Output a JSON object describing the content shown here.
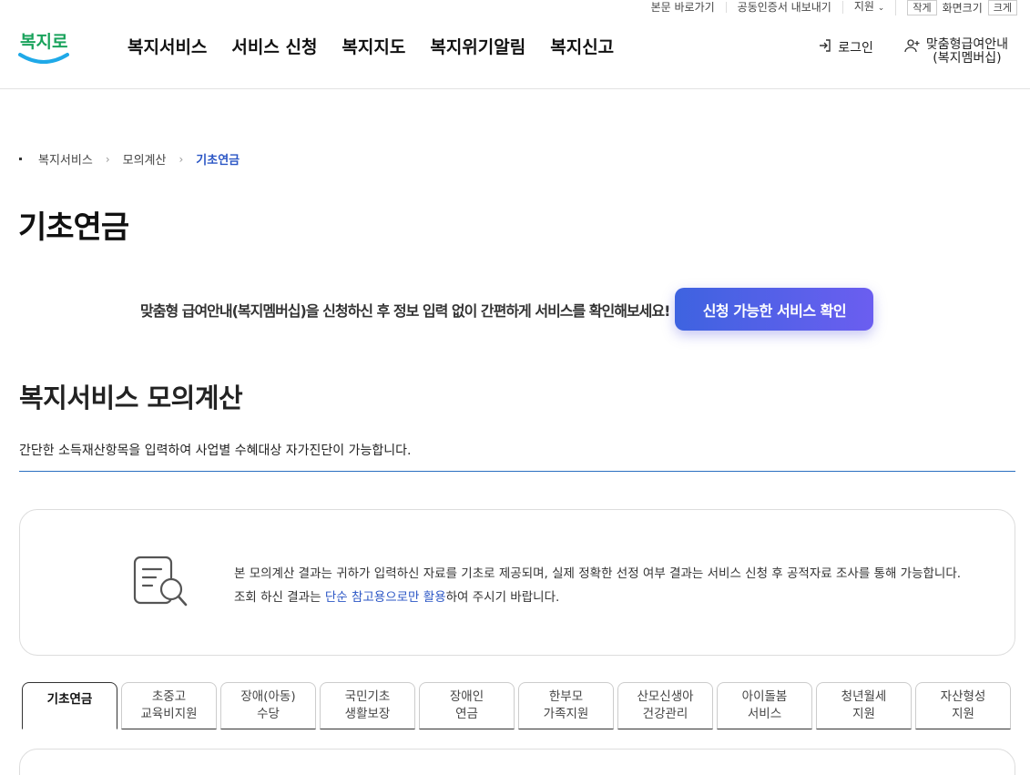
{
  "utility": {
    "skip_link": "본문 바로가기",
    "cert_export": "공동인증서 내보내기",
    "support": "지원",
    "font_small": "작게",
    "screen_size": "화면크기",
    "font_large": "크게"
  },
  "header": {
    "logo_text": "복지로",
    "gnb": [
      "복지서비스",
      "서비스 신청",
      "복지지도",
      "복지위기알림",
      "복지신고"
    ],
    "login": "로그인",
    "membership_line1": "맞춤형급여안내",
    "membership_line2": "(복지멤버십)"
  },
  "breadcrumb": [
    "복지서비스",
    "모의계산",
    "기초연금"
  ],
  "page_title": "기초연금",
  "promo": {
    "text": "맞춤형 급여안내(복지멤버십)을 신청하신 후 정보 입력 없이 간편하게 서비스를 확인해보세요!",
    "button": "신청 가능한 서비스 확인"
  },
  "section": {
    "title": "복지서비스 모의계산",
    "desc": "간단한 소득재산항목을 입력하여 사업별 수혜대상 자가진단이 가능합니다."
  },
  "notice": {
    "text_before": "본 모의계산 결과는 귀하가 입력하신 자료를 기초로 제공되며, 실제 정확한 선정 여부 결과는 서비스 신청 후 공적자료 조사를 통해 가능합니다. 조회 하신 결과는 ",
    "highlight": "단순 참고용으로만 활용",
    "text_after": "하여 주시기 바랍니다."
  },
  "tabs": [
    {
      "l1": "기초연금",
      "l2": ""
    },
    {
      "l1": "초중고",
      "l2": "교육비지원"
    },
    {
      "l1": "장애(아동)",
      "l2": "수당"
    },
    {
      "l1": "국민기초",
      "l2": "생활보장"
    },
    {
      "l1": "장애인",
      "l2": "연금"
    },
    {
      "l1": "한부모",
      "l2": "가족지원"
    },
    {
      "l1": "산모신생아",
      "l2": "건강관리"
    },
    {
      "l1": "아이돌봄",
      "l2": "서비스"
    },
    {
      "l1": "청년월세",
      "l2": "지원"
    },
    {
      "l1": "자산형성",
      "l2": "지원"
    }
  ],
  "colors": {
    "accent": "#2b56c5",
    "button_start": "#3e63e0",
    "button_end": "#6b5ef0",
    "logo_green": "#1aa35c",
    "logo_blue": "#1fa9e8"
  }
}
